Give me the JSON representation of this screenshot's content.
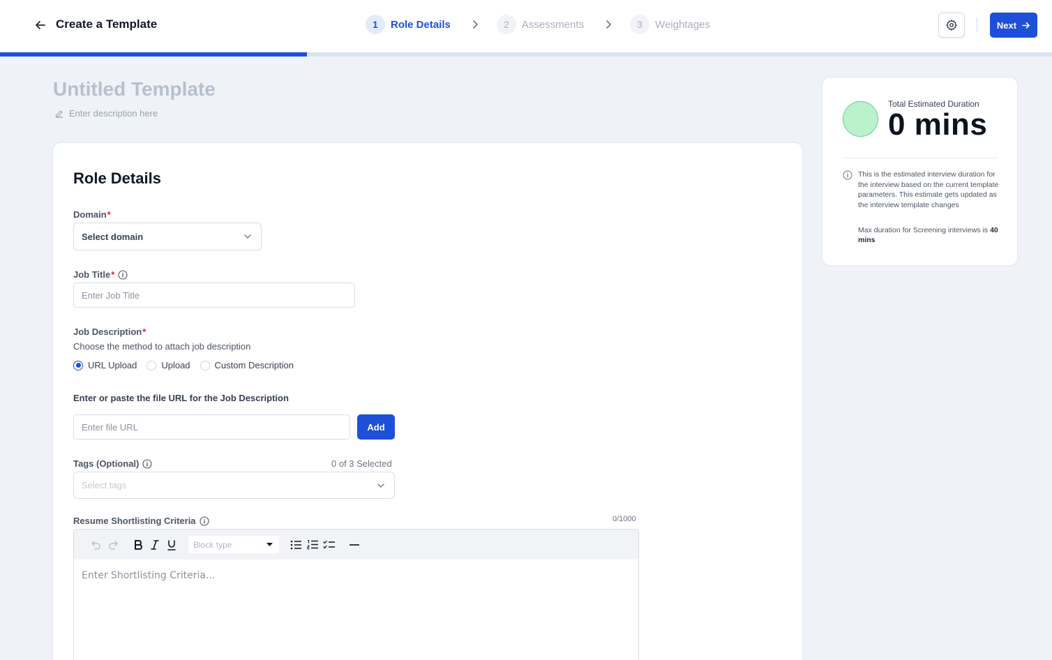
{
  "header": {
    "title": "Create a Template",
    "next_label": "Next",
    "progress_fraction": 0.292
  },
  "stepper": [
    {
      "num": "1",
      "label": "Role Details",
      "state": "active"
    },
    {
      "num": "2",
      "label": "Assessments",
      "state": "inactive"
    },
    {
      "num": "3",
      "label": "Weightages",
      "state": "inactive"
    }
  ],
  "template": {
    "title": "Untitled Template",
    "description_placeholder": "Enter description here"
  },
  "form": {
    "section_title": "Role Details",
    "domain": {
      "label": "Domain",
      "required_mark": "*",
      "value": "Select domain"
    },
    "job_title": {
      "label": "Job Title",
      "required_mark": " *",
      "placeholder": "Enter Job Title"
    },
    "job_description": {
      "label": "Job Description",
      "required_mark": "*",
      "help": "Choose the method to attach job description",
      "options": [
        {
          "label": "URL Upload",
          "checked": true
        },
        {
          "label": "Upload",
          "checked": false
        },
        {
          "label": "Custom Description",
          "checked": false
        }
      ],
      "url_prompt": "Enter or paste the file URL for the Job Description",
      "url_placeholder": "Enter file URL",
      "add_label": "Add"
    },
    "tags": {
      "label": "Tags (Optional)",
      "counter": "0 of 3 Selected",
      "placeholder": "Select tags"
    },
    "criteria": {
      "label": "Resume Shortlisting Criteria",
      "counter": "0/1000",
      "block_type": "Block type",
      "placeholder": "Enter Shortlisting Criteria..."
    }
  },
  "duration": {
    "label": "Total Estimated Duration",
    "value": "0 mins",
    "circle_color": "#b9f2cd",
    "note": "This is the estimated interview duration for the interview based on the current template parameters. This estimate gets updated as the interview template changes",
    "max_prefix": "Max duration for Screening interviews is ",
    "max_value": "40 mins"
  },
  "colors": {
    "accent": "#1d4fd8",
    "required": "#dc2626"
  }
}
